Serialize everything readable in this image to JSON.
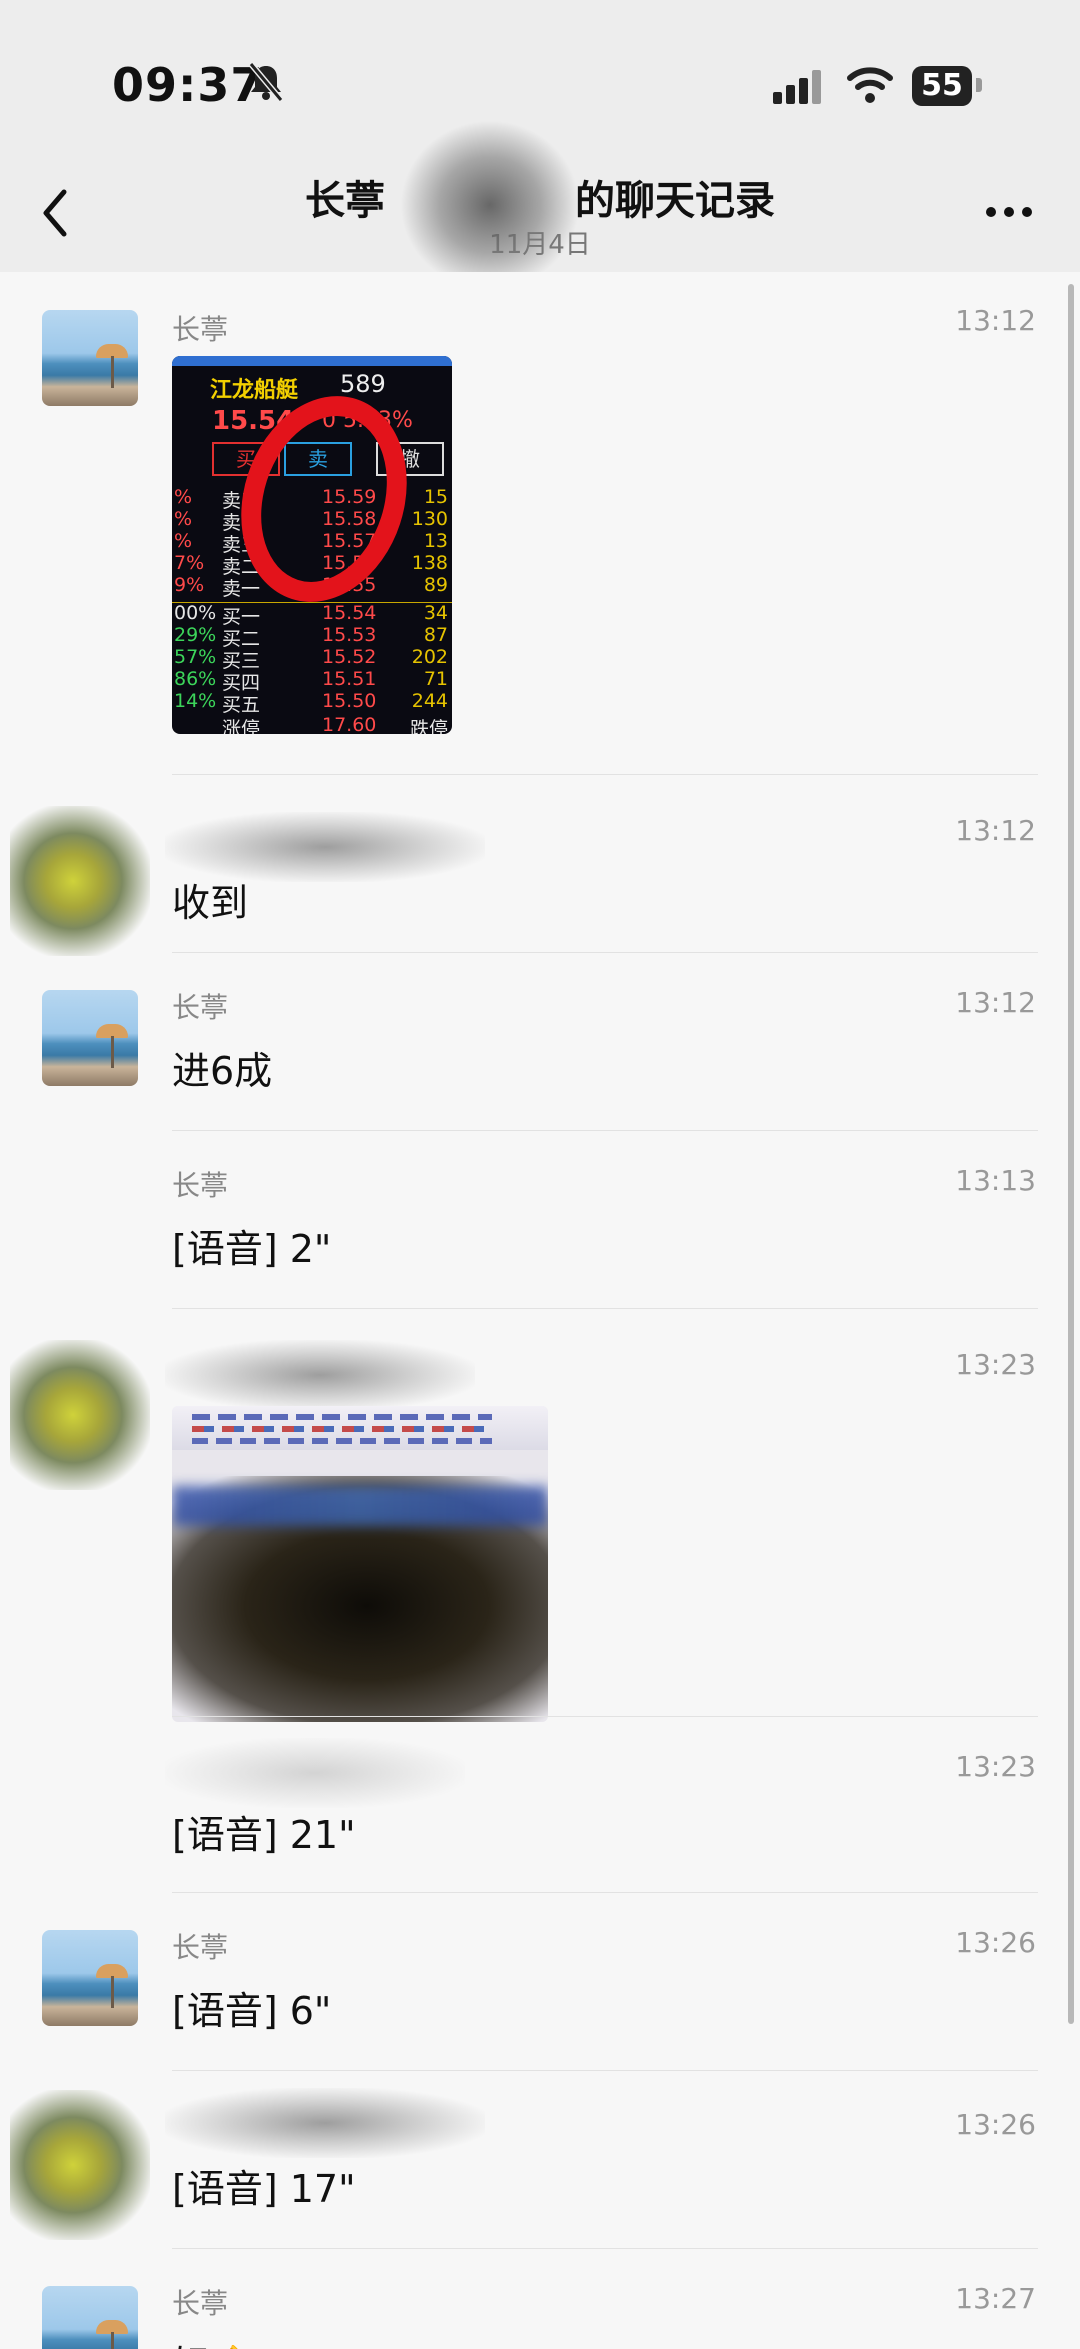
{
  "status_bar": {
    "time": "09:37",
    "battery": "55"
  },
  "header": {
    "title": "长葶▒▒▒▒▒的聊天记录",
    "title_visible_left": "长葶",
    "title_visible_right": "的聊天记录",
    "subtitle": "11月4日"
  },
  "stock_screenshot": {
    "name": "江龙船艇",
    "code": "589",
    "price": "15.54",
    "change": "0 5.93%",
    "buttons": [
      "买",
      "卖",
      "撤"
    ],
    "asks": [
      {
        "label": "卖五",
        "price": "15.59",
        "vol": "15"
      },
      {
        "label": "卖四",
        "price": "15.58",
        "vol": "130"
      },
      {
        "label": "卖三",
        "price": "15.57",
        "vol": "13"
      },
      {
        "label": "卖二",
        "price": "15.56",
        "vol": "138"
      },
      {
        "label": "卖一",
        "price": "15.55",
        "vol": "89"
      }
    ],
    "bids": [
      {
        "label": "买一",
        "price": "15.54",
        "vol": "34"
      },
      {
        "label": "买二",
        "price": "15.53",
        "vol": "87"
      },
      {
        "label": "买三",
        "price": "15.52",
        "vol": "202"
      },
      {
        "label": "买四",
        "price": "15.51",
        "vol": "71"
      },
      {
        "label": "买五",
        "price": "15.50",
        "vol": "244"
      }
    ],
    "pcts": [
      "%",
      "%",
      "%",
      "7%",
      "9%",
      "00%",
      "29%",
      "57%",
      "86%",
      "14%"
    ],
    "limit_label": "涨停",
    "limit_price": "17.60",
    "limit_down_label": "跌停"
  },
  "messages": [
    {
      "sender": "长葶",
      "time": "13:12",
      "text": ""
    },
    {
      "sender": "",
      "time": "13:12",
      "text": "收到"
    },
    {
      "sender": "长葶",
      "time": "13:12",
      "text": "进6成"
    },
    {
      "sender": "长葶",
      "time": "13:13",
      "text": "[语音] 2\""
    },
    {
      "sender": "",
      "time": "13:23",
      "text": ""
    },
    {
      "sender": "",
      "time": "13:23",
      "text": "[语音] 21\""
    },
    {
      "sender": "长葶",
      "time": "13:26",
      "text": "[语音] 6\""
    },
    {
      "sender": "",
      "time": "13:26",
      "text": "[语音] 17\""
    },
    {
      "sender": "长葶",
      "time": "13:27",
      "text": "好👌"
    }
  ]
}
